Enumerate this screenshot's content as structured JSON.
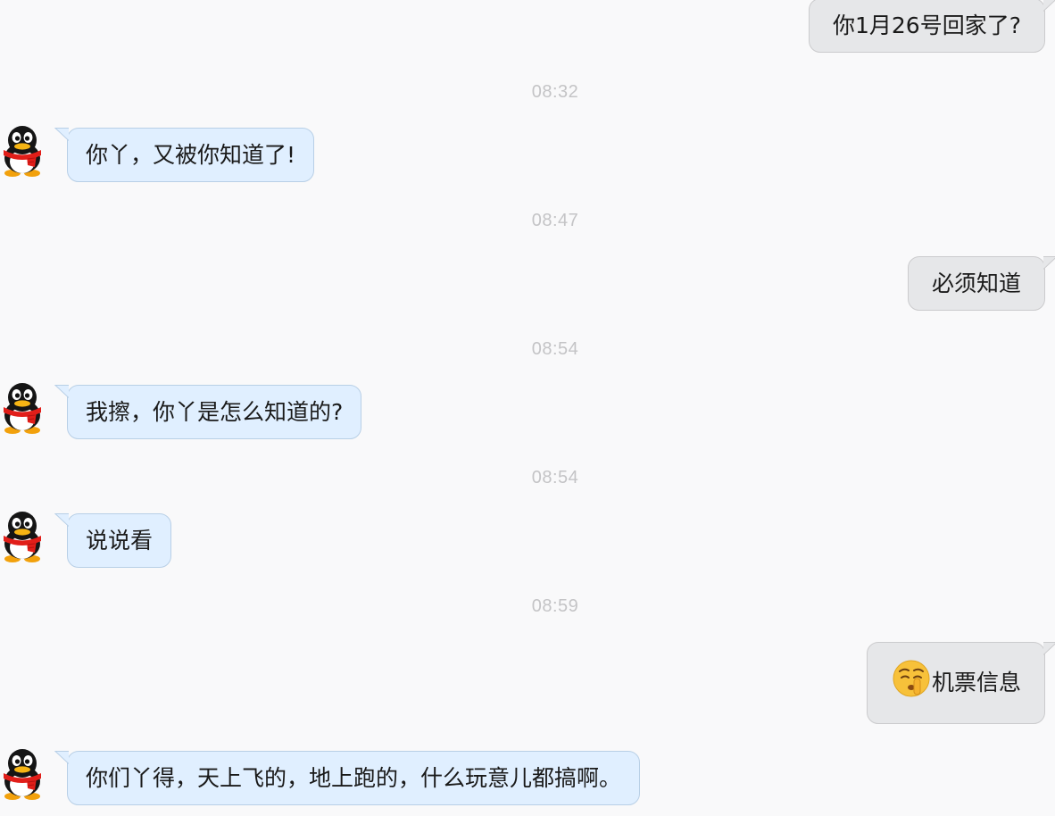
{
  "messages": [
    {
      "type": "sent",
      "text": "你1月26号回家了?"
    },
    {
      "type": "time",
      "text": "08:32"
    },
    {
      "type": "received",
      "sender_avatar": "qq-penguin-icon",
      "text": "你丫，又被你知道了!"
    },
    {
      "type": "time",
      "text": "08:47"
    },
    {
      "type": "sent",
      "text": "必须知道"
    },
    {
      "type": "time",
      "text": "08:54"
    },
    {
      "type": "received",
      "sender_avatar": "qq-penguin-icon",
      "text": "我擦，你丫是怎么知道的?"
    },
    {
      "type": "time",
      "text": "08:54"
    },
    {
      "type": "received",
      "sender_avatar": "qq-penguin-icon",
      "text": "说说看"
    },
    {
      "type": "time",
      "text": "08:59"
    },
    {
      "type": "sent",
      "emoji": "shush-face-emoji",
      "text": "机票信息"
    },
    {
      "type": "received",
      "sender_avatar": "qq-penguin-icon",
      "text": "你们丫得，天上飞的，地上跑的，什么玩意儿都搞啊。"
    }
  ],
  "colors": {
    "background": "#f9f9fa",
    "received_bubble": "#e0efff",
    "received_border": "#b8cfe6",
    "sent_bubble": "#e6e7e9",
    "sent_border": "#cbcbcd",
    "timestamp": "#c4c4c6"
  }
}
